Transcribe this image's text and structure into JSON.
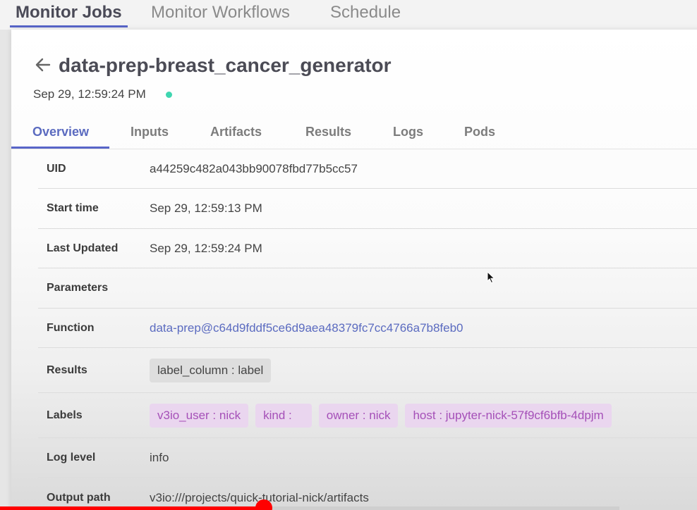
{
  "top_tabs": [
    "Monitor Jobs",
    "Monitor Workflows",
    "Schedule"
  ],
  "header": {
    "back_icon": "arrow-left-icon",
    "title": "data-prep-breast_cancer_generator",
    "date": "Sep 29, 12:59:24 PM",
    "status_color": "#3fd6b0"
  },
  "detail_tabs": [
    "Overview",
    "Inputs",
    "Artifacts",
    "Results",
    "Logs",
    "Pods"
  ],
  "overview": {
    "uid_label": "UID",
    "uid_value": "a44259c482a043bb90078fbd77b5cc57",
    "start_label": "Start time",
    "start_value": "Sep 29, 12:59:13 PM",
    "updated_label": "Last Updated",
    "updated_value": "Sep 29, 12:59:24 PM",
    "parameters_label": "Parameters",
    "function_label": "Function",
    "function_value": "data-prep@c64d9fddf5ce6d9aea48379fc7cc4766a7b8feb0",
    "results_label": "Results",
    "results_chips": [
      "label_column : label"
    ],
    "labels_label": "Labels",
    "labels_chips": [
      "v3io_user : nick",
      "kind :",
      "owner : nick",
      "host : jupyter-nick-57f9cf6bfb-4dpjm"
    ],
    "loglevel_label": "Log level",
    "loglevel_value": "info",
    "output_label": "Output path",
    "output_value": "v3io:///projects/quick-tutorial-nick/artifacts"
  },
  "colors": {
    "accent": "#5865c8",
    "label_chip_text": "#a550b8",
    "progress_red": "#ff0000"
  }
}
